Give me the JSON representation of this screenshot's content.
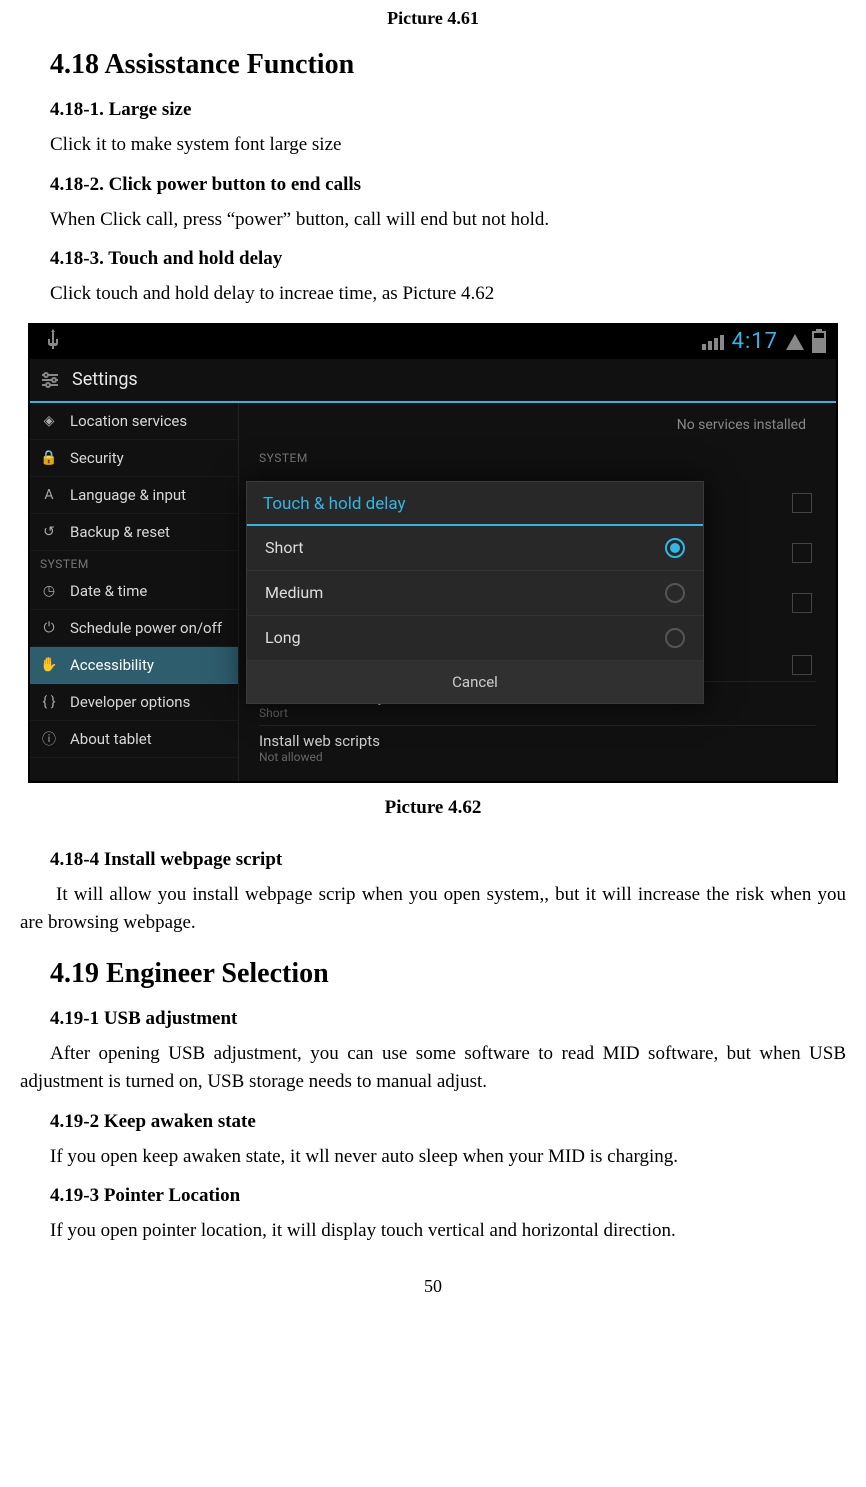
{
  "doc": {
    "caption_top": "Picture 4.61",
    "h_418": "4.18 Assisstance Function",
    "s_418_1_title": "4.18-1. Large size",
    "s_418_1_body": "Click it to make system font large size",
    "s_418_2_title": "4.18-2. Click power button to end calls",
    "s_418_2_body": "When Click call, press “power” button, call will end but not hold.",
    "s_418_3_title": "4.18-3. Touch and hold delay",
    "s_418_3_body": "Click touch and hold delay to increae time, as Picture 4.62",
    "caption_bottom": "Picture 4.62",
    "s_418_4_title": "4.18-4 Install webpage script",
    "s_418_4_body": "It will allow you install webpage scrip when you open system,, but it will increase the risk when you are browsing webpage.",
    "h_419": "4.19 Engineer Selection",
    "s_419_1_title": "4.19-1 USB adjustment",
    "s_419_1_body": "After opening USB adjustment, you can use some software to read MID software, but when USB adjustment is turned on, USB storage needs to manual adjust.",
    "s_419_2_title": "4.19-2 Keep awaken state",
    "s_419_2_body": "If you open keep awaken state, it wll never auto sleep when your MID is charging.",
    "s_419_3_title": "4.19-3 Pointer Location",
    "s_419_3_body": "If you open pointer location, it will display touch vertical and horizontal direction.",
    "page_number": "50"
  },
  "screenshot": {
    "status_time": "4:17",
    "settings_title": "Settings",
    "sidebar": {
      "section_label": "SYSTEM",
      "items": [
        "Location services",
        "Security",
        "Language & input",
        "Backup & reset",
        "Date & time",
        "Schedule power on/off",
        "Accessibility",
        "Developer options",
        "About tablet"
      ]
    },
    "content": {
      "banner": "No services installed",
      "syslabel": "SYSTEM",
      "opt1_main": "Touch & hold delay",
      "opt1_sub": "Short",
      "opt2_main": "Install web scripts",
      "opt2_sub": "Not allowed"
    },
    "dialog": {
      "title": "Touch & hold delay",
      "options": [
        "Short",
        "Medium",
        "Long"
      ],
      "cancel": "Cancel"
    }
  }
}
